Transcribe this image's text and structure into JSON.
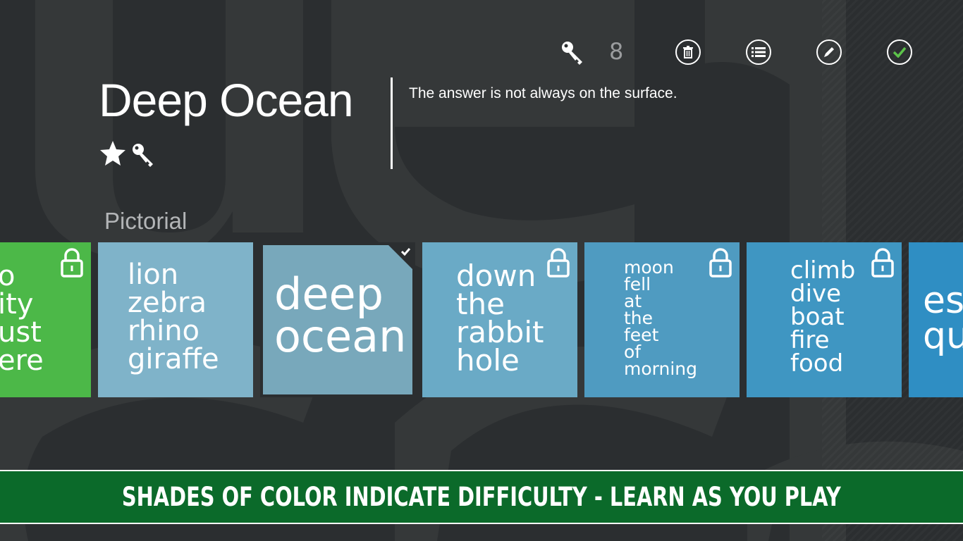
{
  "toolbar": {
    "key_count": "8",
    "icons": [
      "key-icon",
      "trash-icon",
      "list-icon",
      "pencil-icon",
      "check-icon"
    ]
  },
  "puzzle": {
    "title": "Deep Ocean",
    "hint": "The answer is not always on the surface.",
    "category": "Pictorial",
    "badges": [
      "star-icon",
      "key-icon"
    ]
  },
  "tiles": [
    {
      "text": "o\nity\nust\nere",
      "color": "#4cb848",
      "locked": true
    },
    {
      "text": "lion\nzebra\nrhino\ngiraffe",
      "color": "#7fb3c9",
      "locked": false
    },
    {
      "text": "deep\nocean",
      "color": "#78a8bb",
      "locked": false,
      "selected": true
    },
    {
      "text": "down\nthe\nrabbit\nhole",
      "color": "#6aaac6",
      "locked": true
    },
    {
      "text": "moon\nfell\nat\nthe\nfeet\nof\nmorning",
      "color": "#4f9bc1",
      "locked": true
    },
    {
      "text": "climb\ndive\nboat\nfire\nfood",
      "color": "#3f96c2",
      "locked": true
    },
    {
      "text": "es\nqu",
      "color": "#2f8ec3",
      "locked": false
    }
  ],
  "banner": {
    "text": "SHADES OF COLOR INDICATE DIFFICULTY - LEARN AS YOU PLAY"
  },
  "colors": {
    "background": "#2b2e30",
    "banner": "#0b6a2a",
    "accent_check": "#5cc34a"
  }
}
